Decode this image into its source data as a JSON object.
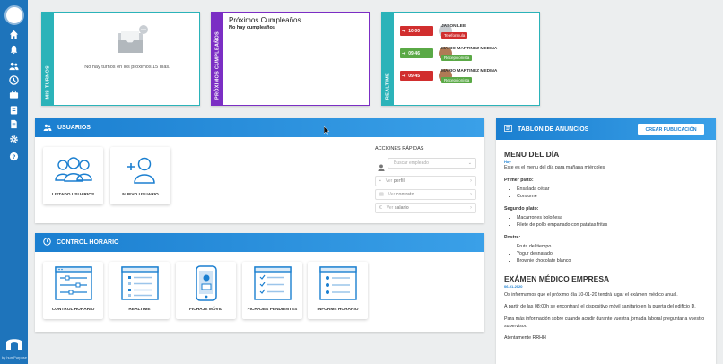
{
  "colors": {
    "sidebar": "#1e74bb",
    "accent": "#1b7fd0",
    "teal": "#2bb3b9",
    "purple": "#7b2ec4",
    "red": "#d12e2e",
    "green": "#5aa946"
  },
  "turnos": {
    "vertical_label": "MIS TURNOS",
    "empty_text": "No hay turnos en los próximos 15 días."
  },
  "cumple": {
    "vertical_label": "PRÓXIMOS CUMPLEAÑOS",
    "title": "Próximos Cumpleaños",
    "subtitle": "No hay cumpleaños"
  },
  "realtime": {
    "vertical_label": "REALTIME",
    "rows": [
      {
        "time": "10:00",
        "name": "JASON LEE",
        "badge": "Teleformula",
        "badge_color": "#d12e2e",
        "clock_color": "#d12e2e"
      },
      {
        "time": "09:46",
        "name": "MARIO MARTINEZ MEDINA",
        "badge": "Recepcionista",
        "badge_color": "#5aa946",
        "clock_color": "#5aa946"
      },
      {
        "time": "09:45",
        "name": "MARIO MARTINEZ MEDINA",
        "badge": "Recepcionista",
        "badge_color": "#5aa946",
        "clock_color": "#d12e2e"
      }
    ]
  },
  "usuarios": {
    "title": "USUARIOS",
    "tiles": [
      "LISTADO USUARIOS",
      "NUEVO USUARIO"
    ],
    "quick_title": "ACCIONES RÁPIDAS",
    "search_placeholder": "Buscar empleado",
    "actions": [
      {
        "pre": "Ver",
        "key": "perfil"
      },
      {
        "pre": "Ver",
        "key": "contrato"
      },
      {
        "pre": "Ver",
        "key": "salario"
      }
    ]
  },
  "control": {
    "title": "CONTROL HORARIO",
    "tiles": [
      "CONTROL HORARIO",
      "REALTIME",
      "FICHAJE MÓVIL",
      "FICHAJES PENDIENTES",
      "INFORME HORARIO"
    ]
  },
  "board": {
    "title": "TABLON DE ANUNCIOS",
    "create_label": "CREAR PUBLICACIÓN",
    "menu_title": "MENU DEL DÍA",
    "menu_date": "Hoy",
    "menu_intro": "Este es el menu del día para mañana miércoles",
    "first_label": "Primer plato:",
    "first": [
      "Ensalada césar",
      "Consomé"
    ],
    "second_label": "Segundo plato:",
    "second": [
      "Macarrones boloñesa",
      "Filete de pollo empanado con patatas fritas"
    ],
    "dessert_label": "Postre:",
    "dessert": [
      "Fruta del tiempo",
      "Yogur desnatado",
      "Brownie chocolate blanco"
    ],
    "exam_title": "EXÁMEN MÉDICO EMPRESA",
    "exam_date": "06-01-2020",
    "exam_p1": "Os informamos que el próximo día 10-01-20 tendrá lugar el exámen médico anual.",
    "exam_p2": "A partir de las 08:00h se encontrará el dispositivo móvil sanitario en la puerta del edificio D.",
    "exam_p3": "Para más información sobre cuando acudir durante vuestra jornada laboral preguntar a vuestro supervisor.",
    "exam_p4": "Atentamente RRHH"
  },
  "brand": {
    "by": "by humPurpose"
  }
}
